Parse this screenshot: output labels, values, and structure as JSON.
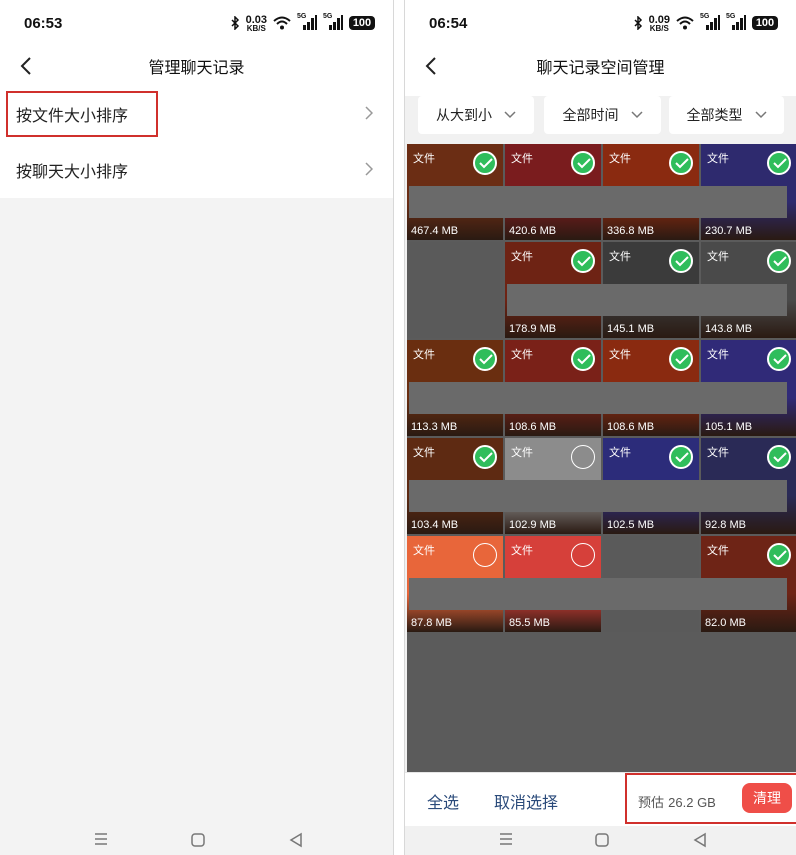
{
  "left": {
    "status": {
      "time": "06:53",
      "speed_value": "0.03",
      "speed_unit": "KB/S",
      "net_tag": "5G",
      "battery": "100"
    },
    "title": "管理聊天记录",
    "menu": [
      {
        "label": "按文件大小排序",
        "highlighted": true
      },
      {
        "label": "按聊天大小排序",
        "highlighted": false
      }
    ]
  },
  "right": {
    "status": {
      "time": "06:54",
      "speed_value": "0.09",
      "speed_unit": "KB/S",
      "net_tag": "5G",
      "battery": "100"
    },
    "title": "聊天记录空间管理",
    "filters": [
      {
        "label": "从大到小"
      },
      {
        "label": "全部时间"
      },
      {
        "label": "全部类型"
      }
    ],
    "tile_label": "文件",
    "tiles": [
      {
        "size": "467.4 MB",
        "checked": true,
        "color": "#6b2d14",
        "show_label": true
      },
      {
        "size": "420.6 MB",
        "checked": true,
        "color": "#7a1c1e",
        "show_label": true
      },
      {
        "size": "336.8 MB",
        "checked": true,
        "color": "#8a2a10",
        "show_label": true
      },
      {
        "size": "230.7 MB",
        "checked": true,
        "color": "#2e2a6e",
        "show_label": true
      },
      {
        "size": "",
        "checked": false,
        "color": "#5a5a5a",
        "show_label": false
      },
      {
        "size": "178.9 MB",
        "checked": true,
        "color": "#6e2314",
        "show_label": true
      },
      {
        "size": "145.1 MB",
        "checked": true,
        "color": "#3b3b3b",
        "show_label": true
      },
      {
        "size": "143.8 MB",
        "checked": true,
        "color": "#4a4a4a",
        "show_label": true
      },
      {
        "size": "113.3 MB",
        "checked": true,
        "color": "#6a2e10",
        "show_label": true
      },
      {
        "size": "108.6 MB",
        "checked": true,
        "color": "#7a2118",
        "show_label": true
      },
      {
        "size": "108.6 MB",
        "checked": true,
        "color": "#8a2a10",
        "show_label": true
      },
      {
        "size": "105.1 MB",
        "checked": true,
        "color": "#302a78",
        "show_label": true
      },
      {
        "size": "103.4 MB",
        "checked": true,
        "color": "#5e2a12",
        "show_label": true
      },
      {
        "size": "102.9 MB",
        "checked": false,
        "color": "#8c8c8c",
        "show_label": true
      },
      {
        "size": "102.5 MB",
        "checked": true,
        "color": "#2c2c7a",
        "show_label": true
      },
      {
        "size": "92.8 MB",
        "checked": true,
        "color": "#2a2a56",
        "show_label": true
      },
      {
        "size": "87.8 MB",
        "checked": false,
        "color": "#e8663a",
        "show_label": true
      },
      {
        "size": "85.5 MB",
        "checked": false,
        "color": "#d6403a",
        "show_label": true
      },
      {
        "size": "",
        "checked": false,
        "color": "#5a5a5a",
        "show_label": false
      },
      {
        "size": "82.0 MB",
        "checked": true,
        "color": "#6e2416",
        "show_label": true
      }
    ],
    "bottom": {
      "select_all": "全选",
      "cancel_select": "取消选择",
      "estimate_label": "预估",
      "estimate_value": "26.2 GB",
      "clean_button": "清理"
    }
  },
  "colors": {
    "check_green": "#2fbd5b",
    "highlight_red": "#d0302c",
    "clean_red": "#ef4e48",
    "action_blue": "#2a4a7a",
    "redaction_gray": "#6a6a6a"
  },
  "icons": [
    "back-chevron-icon",
    "chevron-right-icon",
    "chevron-down-icon",
    "checkmark-icon",
    "bluetooth-icon",
    "wifi-icon",
    "signal-icon",
    "battery-icon",
    "menu-icon",
    "home-icon",
    "back-icon"
  ]
}
